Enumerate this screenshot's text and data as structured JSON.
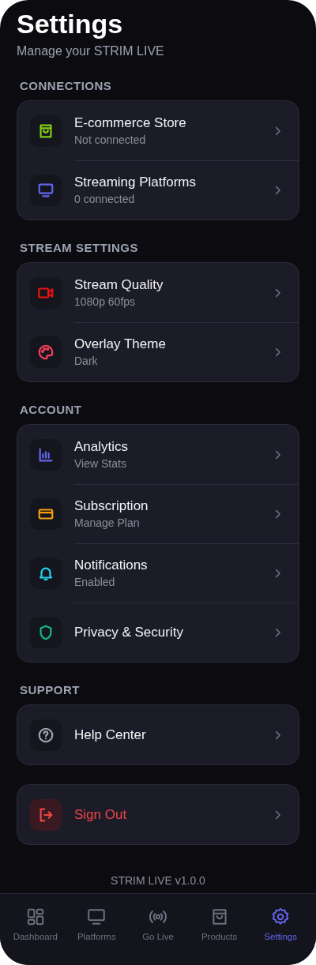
{
  "header": {
    "title": "Settings",
    "subtitle": "Manage your STRIM LIVE"
  },
  "sections": [
    {
      "title": "CONNECTIONS",
      "items": [
        {
          "kind": "bag",
          "color": "#84cc16",
          "title": "E-commerce Store",
          "subtitle": "Not connected"
        },
        {
          "kind": "monitor",
          "color": "#6366f1",
          "title": "Streaming Platforms",
          "subtitle": "0 connected"
        }
      ]
    },
    {
      "title": "STREAM SETTINGS",
      "items": [
        {
          "kind": "video",
          "color": "#ef1111",
          "title": "Stream Quality",
          "subtitle": "1080p 60fps"
        },
        {
          "kind": "palette",
          "color": "#f43f5e",
          "title": "Overlay Theme",
          "subtitle": "Dark"
        }
      ]
    },
    {
      "title": "ACCOUNT",
      "items": [
        {
          "kind": "chart",
          "color": "#6366f1",
          "title": "Analytics",
          "subtitle": "View Stats"
        },
        {
          "kind": "card",
          "color": "#f59e0b",
          "title": "Subscription",
          "subtitle": "Manage Plan"
        },
        {
          "kind": "bell",
          "color": "#22d3ee",
          "title": "Notifications",
          "subtitle": "Enabled"
        },
        {
          "kind": "shield",
          "color": "#10b981",
          "title": "Privacy & Security"
        }
      ]
    },
    {
      "title": "SUPPORT",
      "items": [
        {
          "kind": "help",
          "color": "#9ca3af",
          "title": "Help Center"
        }
      ]
    }
  ],
  "sign_out": {
    "label": "Sign Out"
  },
  "version": "STRIM LIVE v1.0.0",
  "nav": [
    {
      "kind": "dashboard",
      "label": "Dashboard",
      "selected": false
    },
    {
      "kind": "monitor",
      "label": "Platforms",
      "selected": false
    },
    {
      "kind": "live",
      "label": "Go Live",
      "selected": false
    },
    {
      "kind": "bag",
      "label": "Products",
      "selected": false
    },
    {
      "kind": "gear",
      "label": "Settings",
      "selected": true
    }
  ]
}
